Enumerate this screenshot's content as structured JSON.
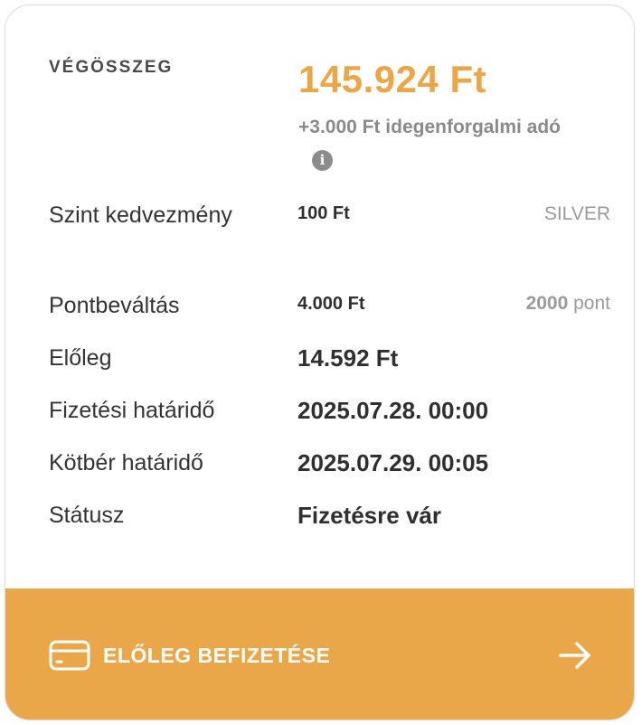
{
  "summary": {
    "total_label": "VÉGÖSSZEG",
    "total_value": "145.924 Ft",
    "tax_note": "+3.000 Ft idegenforgalmi adó",
    "info_icon": "info-icon"
  },
  "rows": [
    {
      "label": "Szint kedvezmény",
      "value": "100 Ft",
      "extra": "SILVER"
    },
    {
      "label": "Pontbeváltás",
      "value": "4.000 Ft",
      "extra_number": "2000",
      "extra_unit": " pont"
    },
    {
      "label": "Előleg",
      "value": "14.592 Ft"
    },
    {
      "label": "Fizetési határidő",
      "value": "2025.07.28. 00:00"
    },
    {
      "label": "Kötbér határidő",
      "value": "2025.07.29. 00:05"
    },
    {
      "label": "Státusz",
      "value": "Fizetésre vár"
    }
  ],
  "footer": {
    "button_label": "ELŐLEG BEFIZETÉSE",
    "left_icon": "credit-card-icon",
    "right_icon": "arrow-right-icon"
  },
  "colors": {
    "accent": "#eaa74a",
    "muted": "#9a9a9a",
    "text": "#2f2f2f"
  }
}
